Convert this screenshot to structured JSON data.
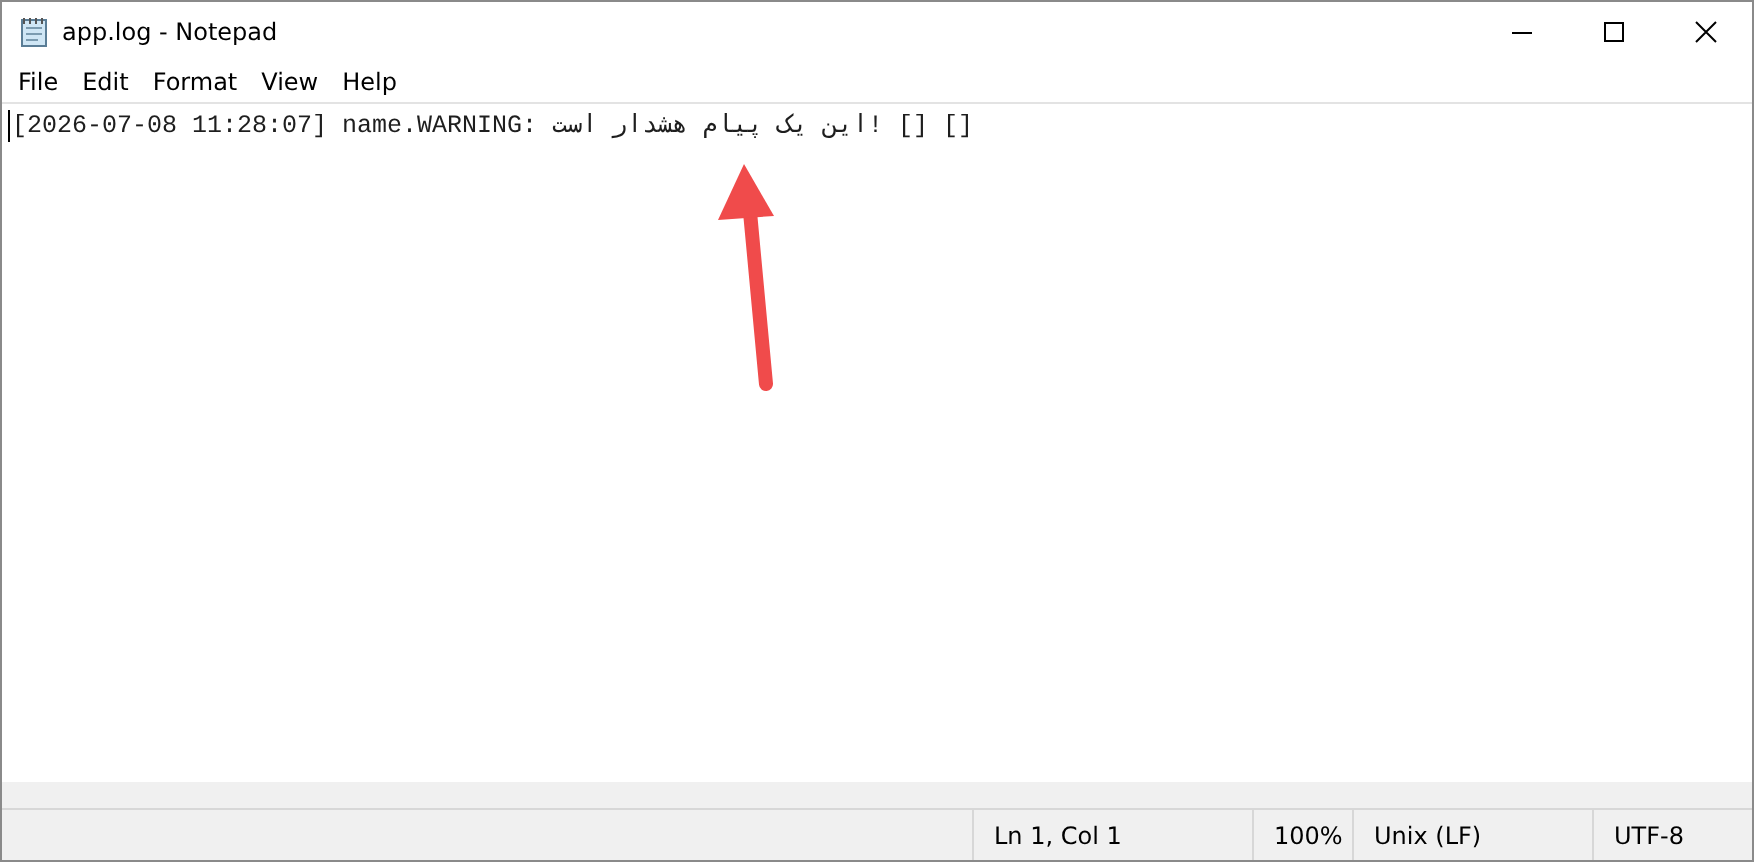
{
  "window": {
    "title": "app.log - Notepad"
  },
  "menu": [
    "File",
    "Edit",
    "Format",
    "View",
    "Help"
  ],
  "editor": {
    "lines": [
      "[2026-07-08 11:28:07] name.WARNING: این یک پیام هشدار است! [] []"
    ]
  },
  "status_bar": [
    "Ln 1, Col 1",
    "100%",
    "Unix (LF)",
    "UTF-8"
  ]
}
